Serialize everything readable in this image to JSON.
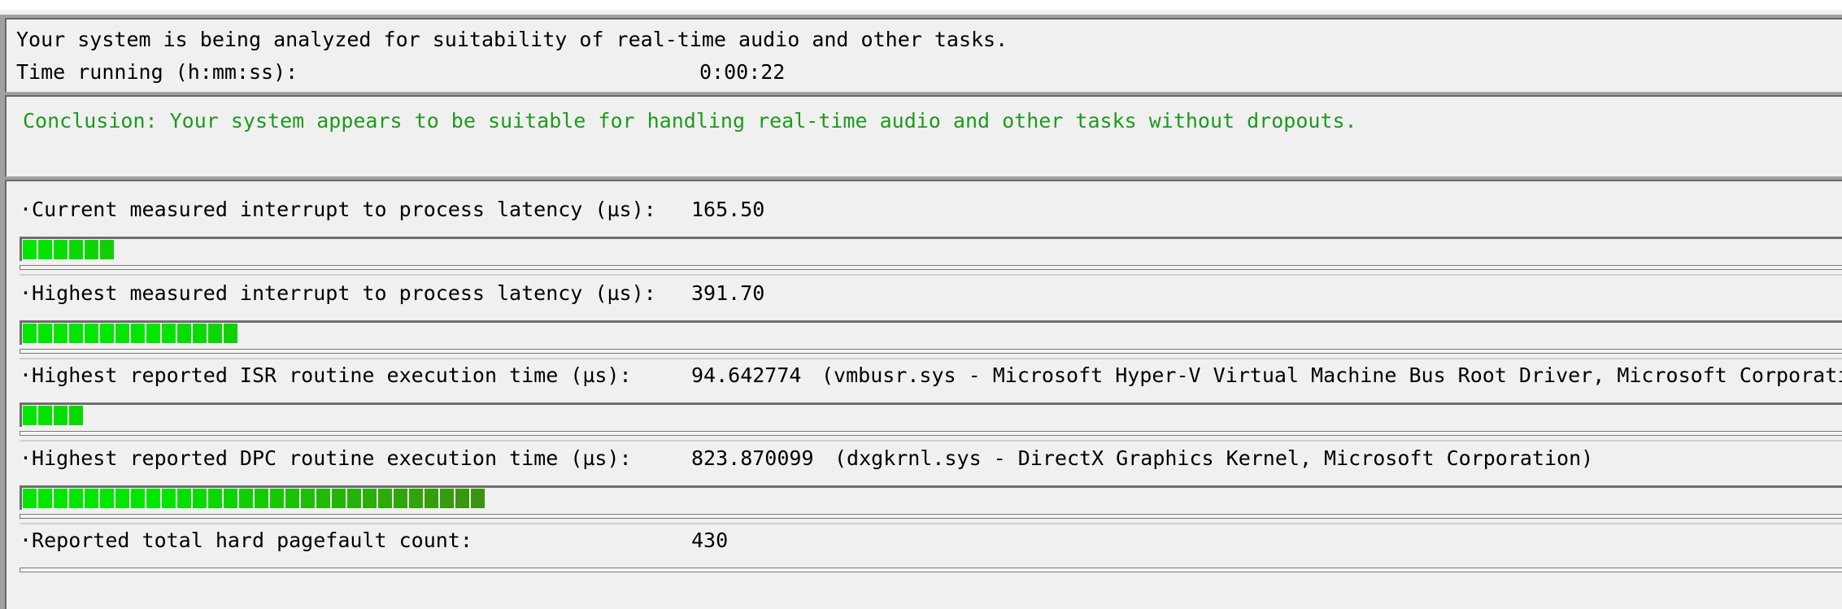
{
  "status": {
    "analyzing_text": "Your system is being analyzed for suitability of real-time audio and other tasks.",
    "time_label": "Time running (h:mm:ss):",
    "time_value": "0:00:22"
  },
  "conclusion": {
    "text": "Conclusion: Your system appears to be suitable for handling real-time audio and other tasks without dropouts.",
    "color": "#1d9a1d"
  },
  "metrics": [
    {
      "label": "·Current measured interrupt to process latency (µs):",
      "value": "165.50",
      "detail": "",
      "segments": 6
    },
    {
      "label": "·Highest measured interrupt to process latency (µs):",
      "value": "391.70",
      "detail": "",
      "segments": 14
    },
    {
      "label": "·Highest reported ISR routine execution time (µs):",
      "value": "94.642774",
      "detail": "(vmbusr.sys - Microsoft Hyper-V Virtual Machine Bus Root Driver, Microsoft Corporation)",
      "segments": 4
    },
    {
      "label": "·Highest reported DPC routine execution time (µs):",
      "value": "823.870099",
      "detail": "(dxgkrnl.sys - DirectX Graphics Kernel, Microsoft Corporation)",
      "segments": 30
    },
    {
      "label": "·Reported total hard pagefault count:",
      "value": "430",
      "detail": "",
      "segments": 0
    }
  ],
  "colors": {
    "bright_green": "#00e600",
    "dark_green": "#3f8f0f"
  }
}
